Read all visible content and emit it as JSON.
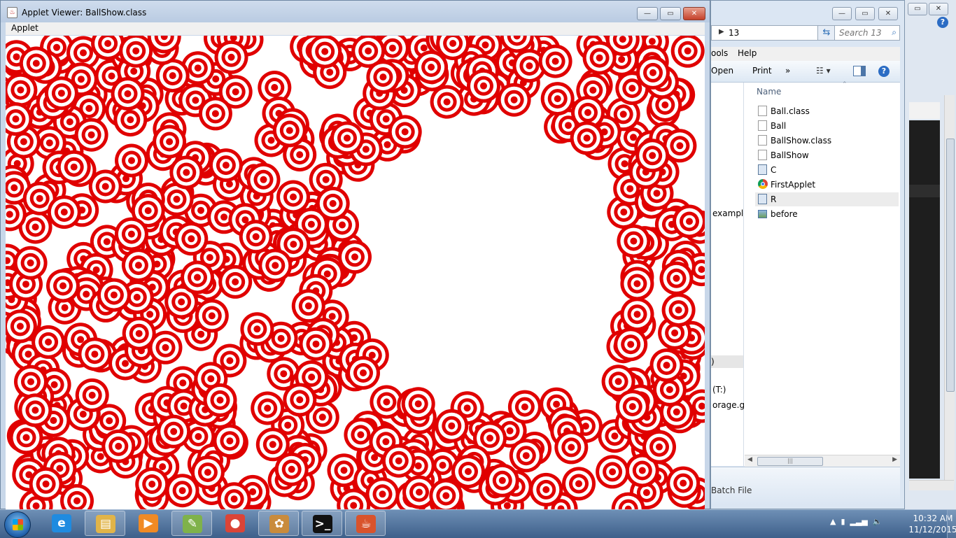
{
  "applet_window": {
    "title": "Applet Viewer: BallShow.class",
    "menu": "Applet",
    "controls": {
      "minimize": "—",
      "maximize": "▭",
      "close": "✕"
    }
  },
  "explorer_window": {
    "address_segment": "13",
    "search_placeholder": "Search 13",
    "menu": {
      "tools": "ools",
      "help": "Help"
    },
    "commands": {
      "open": "Open",
      "print": "Print",
      "more": "»"
    },
    "nav_items": {
      "example": "example",
      "drive": "(T:)",
      "storage": "orage.gu",
      "paren": ")"
    },
    "column_header": "Name",
    "files": [
      {
        "name": "Ball.class",
        "icon": "file-icon",
        "selected": false
      },
      {
        "name": "Ball",
        "icon": "file-icon",
        "selected": false
      },
      {
        "name": "BallShow.class",
        "icon": "file-icon",
        "selected": false
      },
      {
        "name": "BallShow",
        "icon": "file-icon",
        "selected": false
      },
      {
        "name": "C",
        "icon": "settings-file-icon",
        "selected": false
      },
      {
        "name": "FirstApplet",
        "icon": "chrome-icon",
        "selected": false
      },
      {
        "name": "R",
        "icon": "settings-file-icon",
        "selected": true
      },
      {
        "name": "before",
        "icon": "image-icon",
        "selected": false
      }
    ],
    "details_text": "Batch File"
  },
  "taskbar": {
    "apps": [
      {
        "name": "internet-explorer-icon",
        "glyph": "e",
        "color": "#1f8be0",
        "active": false
      },
      {
        "name": "file-explorer-icon",
        "glyph": "▤",
        "color": "#e1b449",
        "active": true
      },
      {
        "name": "media-player-icon",
        "glyph": "▶",
        "color": "#f08a24",
        "active": false
      },
      {
        "name": "notepad-plus-icon",
        "glyph": "✎",
        "color": "#7fb24a",
        "active": true
      },
      {
        "name": "chrome-icon",
        "glyph": "●",
        "color": "#db4437",
        "active": false
      },
      {
        "name": "paint-icon",
        "glyph": "✿",
        "color": "#c98b3c",
        "active": true
      },
      {
        "name": "command-prompt-icon",
        "glyph": ">_",
        "color": "#111111",
        "active": true
      },
      {
        "name": "java-icon",
        "glyph": "☕",
        "color": "#d9532c",
        "active": true
      }
    ],
    "clock": {
      "time": "10:32 AM",
      "date": "11/12/2015"
    }
  },
  "colors": {
    "ring": "#e00000",
    "canvas": "#ffffff",
    "titlebar": "#c8d7e9"
  }
}
